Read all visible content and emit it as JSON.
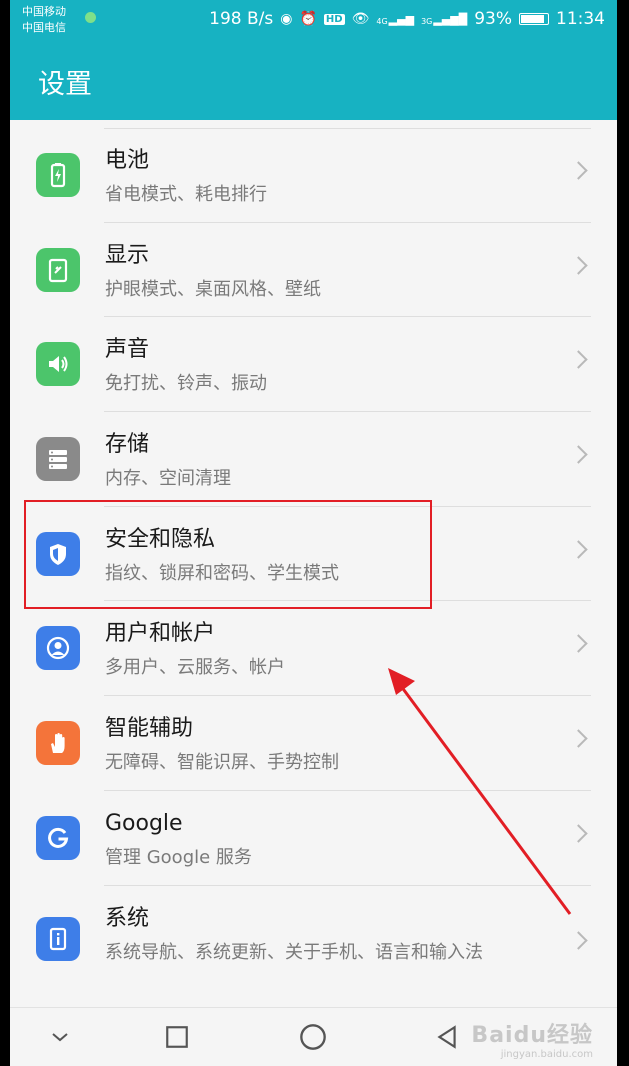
{
  "status_bar": {
    "carrier_1": "中国移动",
    "carrier_2": "中国电信",
    "speed": "198 B/s",
    "battery": "93%",
    "time": "11:34",
    "hd_badge": "HD",
    "net_4g": "4G",
    "net_3g": "3G"
  },
  "app_bar": {
    "title": "设置"
  },
  "items": [
    {
      "label": "电池",
      "sub": "省电模式、耗电排行",
      "icon": "battery-icon",
      "color": "#4cc56b"
    },
    {
      "label": "显示",
      "sub": "护眼模式、桌面风格、壁纸",
      "icon": "display-icon",
      "color": "#4cc56b"
    },
    {
      "label": "声音",
      "sub": "免打扰、铃声、振动",
      "icon": "speaker-icon",
      "color": "#4cc56b"
    },
    {
      "label": "存储",
      "sub": "内存、空间清理",
      "icon": "storage-icon",
      "color": "#8a8a8a"
    },
    {
      "label": "安全和隐私",
      "sub": "指纹、锁屏和密码、学生模式",
      "icon": "shield-icon",
      "color": "#3e7ee8"
    },
    {
      "label": "用户和帐户",
      "sub": "多用户、云服务、帐户",
      "icon": "user-icon",
      "color": "#3e7ee8"
    },
    {
      "label": "智能辅助",
      "sub": "无障碍、智能识屏、手势控制",
      "icon": "hand-icon",
      "color": "#f4743a"
    },
    {
      "label": "Google",
      "sub": "管理 Google 服务",
      "icon": "google-icon",
      "color": "#3e7ee8"
    },
    {
      "label": "系统",
      "sub": "系统导航、系统更新、关于手机、语言和输入法",
      "icon": "system-info-icon",
      "color": "#3e7ee8"
    }
  ],
  "annotations": {
    "highlight_color": "#e21e25",
    "arrow_color": "#e21e25"
  },
  "watermark": {
    "line1": "Baidu经验",
    "line2": "jingyan.baidu.com"
  }
}
